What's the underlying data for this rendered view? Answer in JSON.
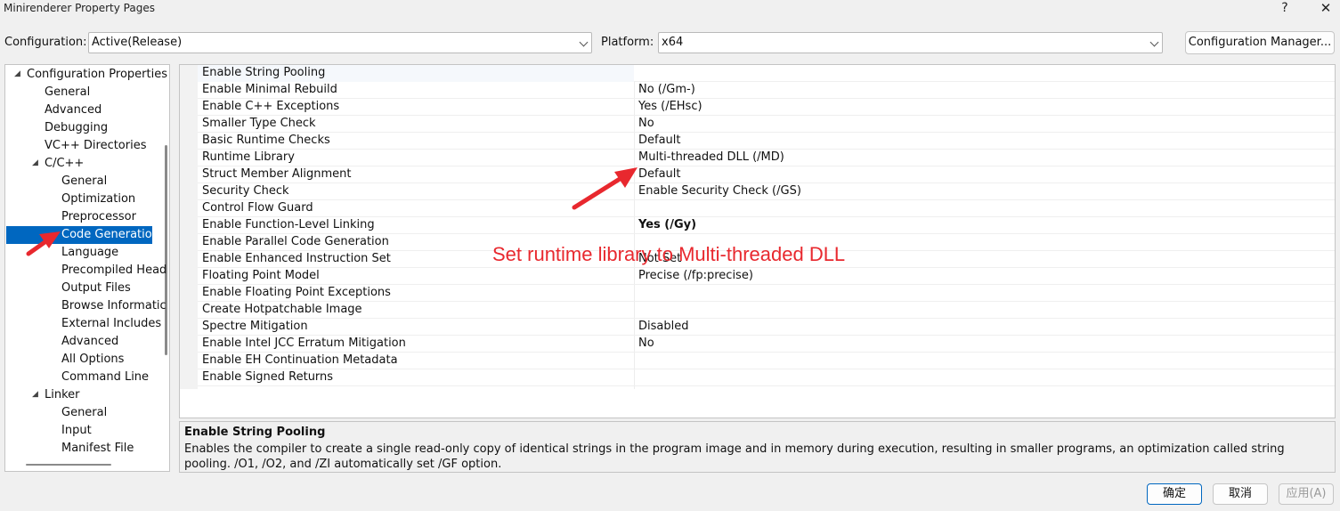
{
  "window": {
    "title": "Minirenderer Property Pages",
    "help_glyph": "?",
    "close_glyph": "✕"
  },
  "config": {
    "configuration_label": "Configuration:",
    "configuration_value": "Active(Release)",
    "platform_label": "Platform:",
    "platform_value": "x64",
    "manager_label": "Configuration Manager..."
  },
  "tree": {
    "items": [
      {
        "label": "Configuration Properties",
        "level": 0,
        "expanded": true
      },
      {
        "label": "General",
        "level": 1
      },
      {
        "label": "Advanced",
        "level": 1
      },
      {
        "label": "Debugging",
        "level": 1
      },
      {
        "label": "VC++ Directories",
        "level": 1
      },
      {
        "label": "C/C++",
        "level": 1,
        "expanded": true
      },
      {
        "label": "General",
        "level": 2
      },
      {
        "label": "Optimization",
        "level": 2
      },
      {
        "label": "Preprocessor",
        "level": 2
      },
      {
        "label": "Code Generation",
        "level": 2,
        "selected": true
      },
      {
        "label": "Language",
        "level": 2
      },
      {
        "label": "Precompiled Head",
        "level": 2
      },
      {
        "label": "Output Files",
        "level": 2
      },
      {
        "label": "Browse Informatic",
        "level": 2
      },
      {
        "label": "External Includes",
        "level": 2
      },
      {
        "label": "Advanced",
        "level": 2
      },
      {
        "label": "All Options",
        "level": 2
      },
      {
        "label": "Command Line",
        "level": 2
      },
      {
        "label": "Linker",
        "level": 1,
        "expanded": true
      },
      {
        "label": "General",
        "level": 2
      },
      {
        "label": "Input",
        "level": 2
      },
      {
        "label": "Manifest File",
        "level": 2
      }
    ]
  },
  "properties": [
    {
      "name": "Enable String Pooling",
      "value": ""
    },
    {
      "name": "Enable Minimal Rebuild",
      "value": "No (/Gm-)"
    },
    {
      "name": "Enable C++ Exceptions",
      "value": "Yes (/EHsc)"
    },
    {
      "name": "Smaller Type Check",
      "value": "No"
    },
    {
      "name": "Basic Runtime Checks",
      "value": "Default"
    },
    {
      "name": "Runtime Library",
      "value": "Multi-threaded DLL (/MD)"
    },
    {
      "name": "Struct Member Alignment",
      "value": "Default"
    },
    {
      "name": "Security Check",
      "value": "Enable Security Check (/GS)"
    },
    {
      "name": "Control Flow Guard",
      "value": ""
    },
    {
      "name": "Enable Function-Level Linking",
      "value": "Yes (/Gy)",
      "bold": true
    },
    {
      "name": "Enable Parallel Code Generation",
      "value": ""
    },
    {
      "name": "Enable Enhanced Instruction Set",
      "value": "Not Set"
    },
    {
      "name": "Floating Point Model",
      "value": "Precise (/fp:precise)"
    },
    {
      "name": "Enable Floating Point Exceptions",
      "value": ""
    },
    {
      "name": "Create Hotpatchable Image",
      "value": ""
    },
    {
      "name": "Spectre Mitigation",
      "value": "Disabled"
    },
    {
      "name": "Enable Intel JCC Erratum Mitigation",
      "value": "No"
    },
    {
      "name": "Enable EH Continuation Metadata",
      "value": ""
    },
    {
      "name": "Enable Signed Returns",
      "value": ""
    }
  ],
  "annotation": {
    "text": "Set runtime library to Multi-threaded DLL",
    "color": "#e8282e"
  },
  "description": {
    "title": "Enable String Pooling",
    "text": "Enables the compiler to create a single read-only copy of identical strings in the program image and in memory during execution, resulting in smaller programs, an optimization called string pooling. /O1, /O2, and /ZI automatically set /GF option."
  },
  "buttons": {
    "ok": "确定",
    "cancel": "取消",
    "apply": "应用(A)"
  },
  "colors": {
    "selection": "#0067c0",
    "arrow": "#e8282e"
  }
}
